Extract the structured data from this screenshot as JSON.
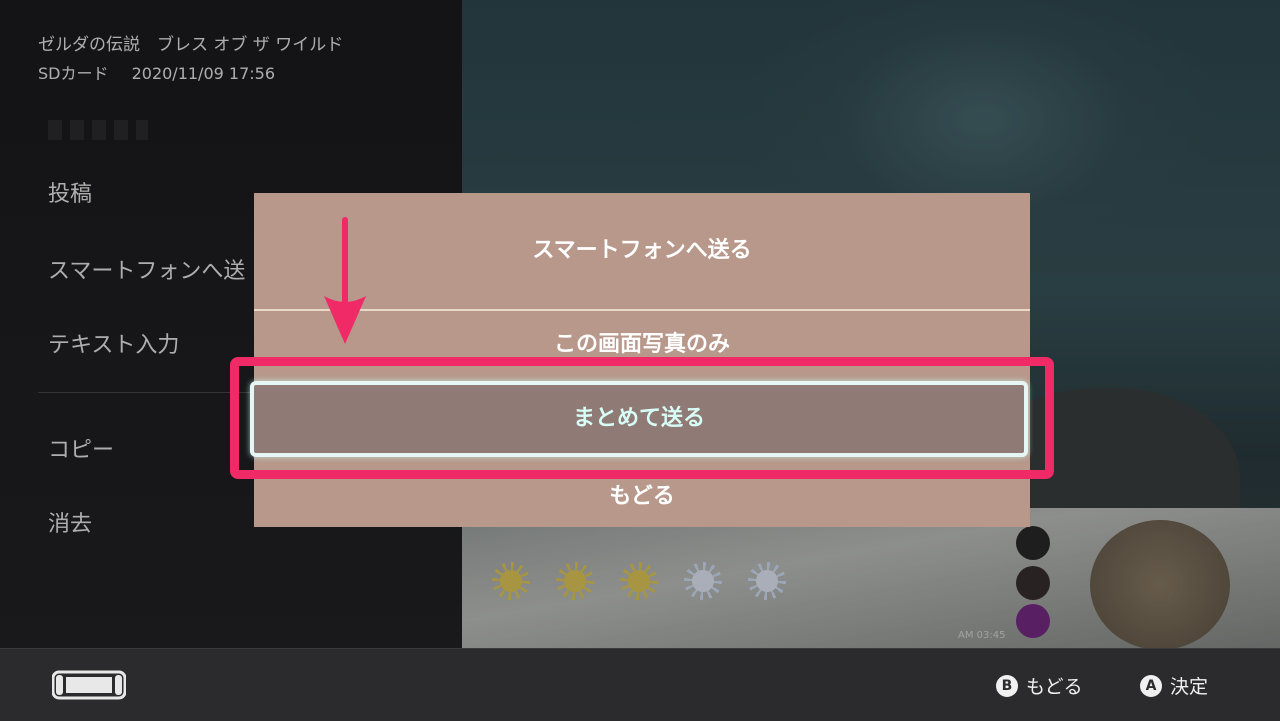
{
  "left_panel": {
    "game_title": "ゼルダの伝説　ブレス オブ ザ ワイルド",
    "storage": "SDカード",
    "datetime": "2020/11/09 17:56",
    "menu": {
      "post": "投稿",
      "send_to_smartphone": "スマートフォンへ送",
      "text_input": "テキスト入力",
      "copy": "コピー",
      "delete": "消去"
    }
  },
  "dialog": {
    "title": "スマートフォンへ送る",
    "options": [
      "この画面写真のみ",
      "まとめて送る",
      "もどる"
    ],
    "selected_index": 1
  },
  "hud": {
    "clock": "AM 03:45"
  },
  "bottom_bar": {
    "back_button": "B",
    "back_label": "もどる",
    "confirm_button": "A",
    "confirm_label": "決定"
  },
  "colors": {
    "dialog_bg": "#b7988b",
    "highlight": "#ef2a66",
    "selection_border": "#e6f6f5"
  }
}
